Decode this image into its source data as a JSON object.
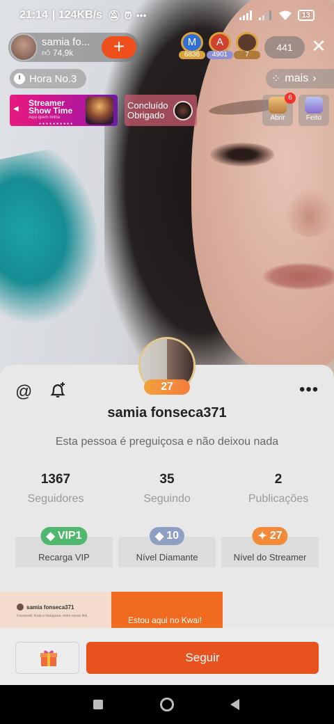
{
  "status_bar": {
    "time": "21:14",
    "speed": "124KB/s",
    "battery": "13"
  },
  "live": {
    "streamer_name": "samia fo...",
    "likes": "74,9k",
    "follow_plus": "+",
    "ranks": [
      {
        "letter": "M",
        "count": "6836",
        "color": "#2f6fd6"
      },
      {
        "letter": "A",
        "count": "4901",
        "color": "#d0402f"
      },
      {
        "letter": "",
        "count": "7",
        "color": "#5a3b2e"
      }
    ],
    "viewers": "441",
    "hour_label": "Hora No.3",
    "more_label": "mais",
    "banner_showtime": {
      "line1": "Streamer",
      "line2": "Show Time",
      "tagline": "Aqui quem brilha"
    },
    "banner_done": {
      "line1": "Concluído",
      "line2": "Obrigado"
    },
    "side_buttons": [
      {
        "label": "Abrir",
        "badge": "6"
      },
      {
        "label": "Feito"
      }
    ]
  },
  "profile": {
    "level_chip": "27",
    "username": "samia fonseca371",
    "bio": "Esta pessoa é preguiçosa e não deixou nada",
    "stats": [
      {
        "value": "1367",
        "label": "Seguidores"
      },
      {
        "value": "35",
        "label": "Seguindo"
      },
      {
        "value": "2",
        "label": "Publicações"
      }
    ],
    "level_cards": [
      {
        "pill": "VIP1",
        "caption": "Recarga VIP",
        "color": "#4fb86e"
      },
      {
        "pill": "10",
        "caption": "Nível Diamante",
        "color": "#8f9fc4"
      },
      {
        "pill": "27",
        "caption": "Nível do Streamer",
        "color": "#f28a3a"
      }
    ],
    "promo": {
      "card_name": "samia fonseca371",
      "card_sub": "Facebook: Kwai e Instagram: entre nesse link",
      "card_b_text": "Estou aqui no Kwai!"
    },
    "follow_button": "Seguir"
  }
}
